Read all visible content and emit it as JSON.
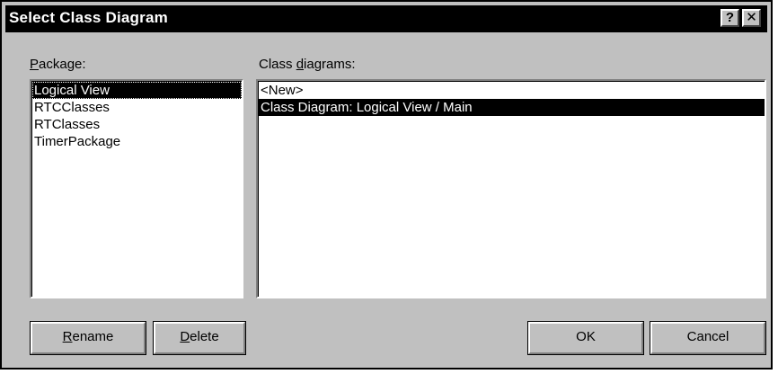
{
  "window": {
    "title": "Select Class Diagram",
    "help_glyph": "?",
    "close_glyph": "✕"
  },
  "package": {
    "label": "Package:",
    "items": [
      "Logical View",
      "RTCClasses",
      "RTClasses",
      "TimerPackage"
    ],
    "selected": "Logical View"
  },
  "diagrams": {
    "label_pre": "Class ",
    "label_hot": "d",
    "label_post": "iagrams:",
    "items": [
      "<New>",
      "Class Diagram: Logical View / Main"
    ],
    "selected": "Class Diagram: Logical View / Main"
  },
  "buttons": {
    "rename": "Rename",
    "delete": "Delete",
    "ok": "OK",
    "cancel": "Cancel"
  },
  "colors": {
    "face": "#c0c0c0",
    "titlebar": "#000000",
    "selection": "#000000"
  }
}
